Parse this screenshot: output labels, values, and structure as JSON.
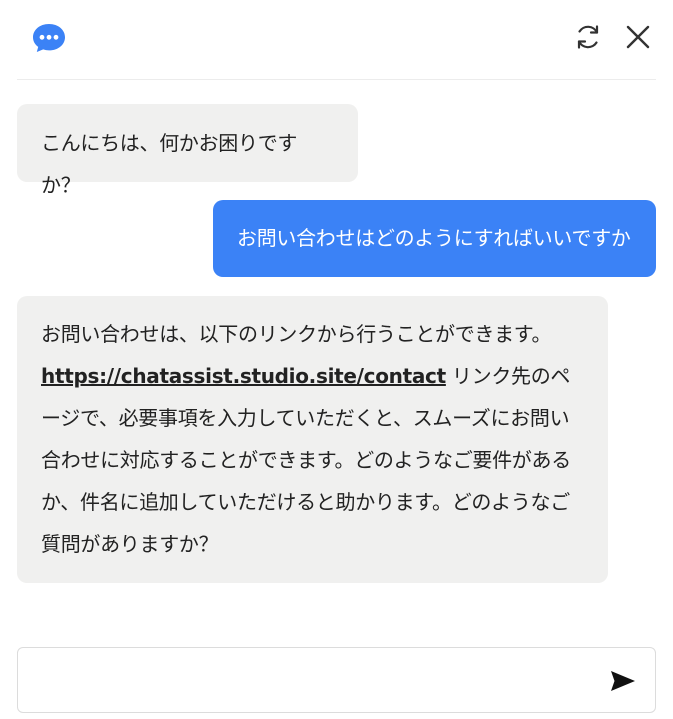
{
  "header": {
    "logo_icon": "chat-bubble-icon",
    "refresh_icon": "refresh-icon",
    "close_icon": "close-icon",
    "accent_color": "#3b82f6"
  },
  "messages": [
    {
      "role": "bot",
      "text": "こんにちは、何かお困りですか？"
    },
    {
      "role": "user",
      "text": "お問い合わせはどのようにすればいいですか"
    },
    {
      "role": "bot",
      "text_before": "お問い合わせは、以下のリンクから行うことができます。",
      "link_text": "https://chatassist.studio.site/contact",
      "text_after": " リンク先のページで、必要事項を入力していただくと、スムーズにお問い合わせに対応することができます。どのようなご要件があるか、件名に追加していただけると助かります。どのようなご質問がありますか？"
    }
  ],
  "composer": {
    "input_value": "",
    "send_icon": "send-icon"
  }
}
